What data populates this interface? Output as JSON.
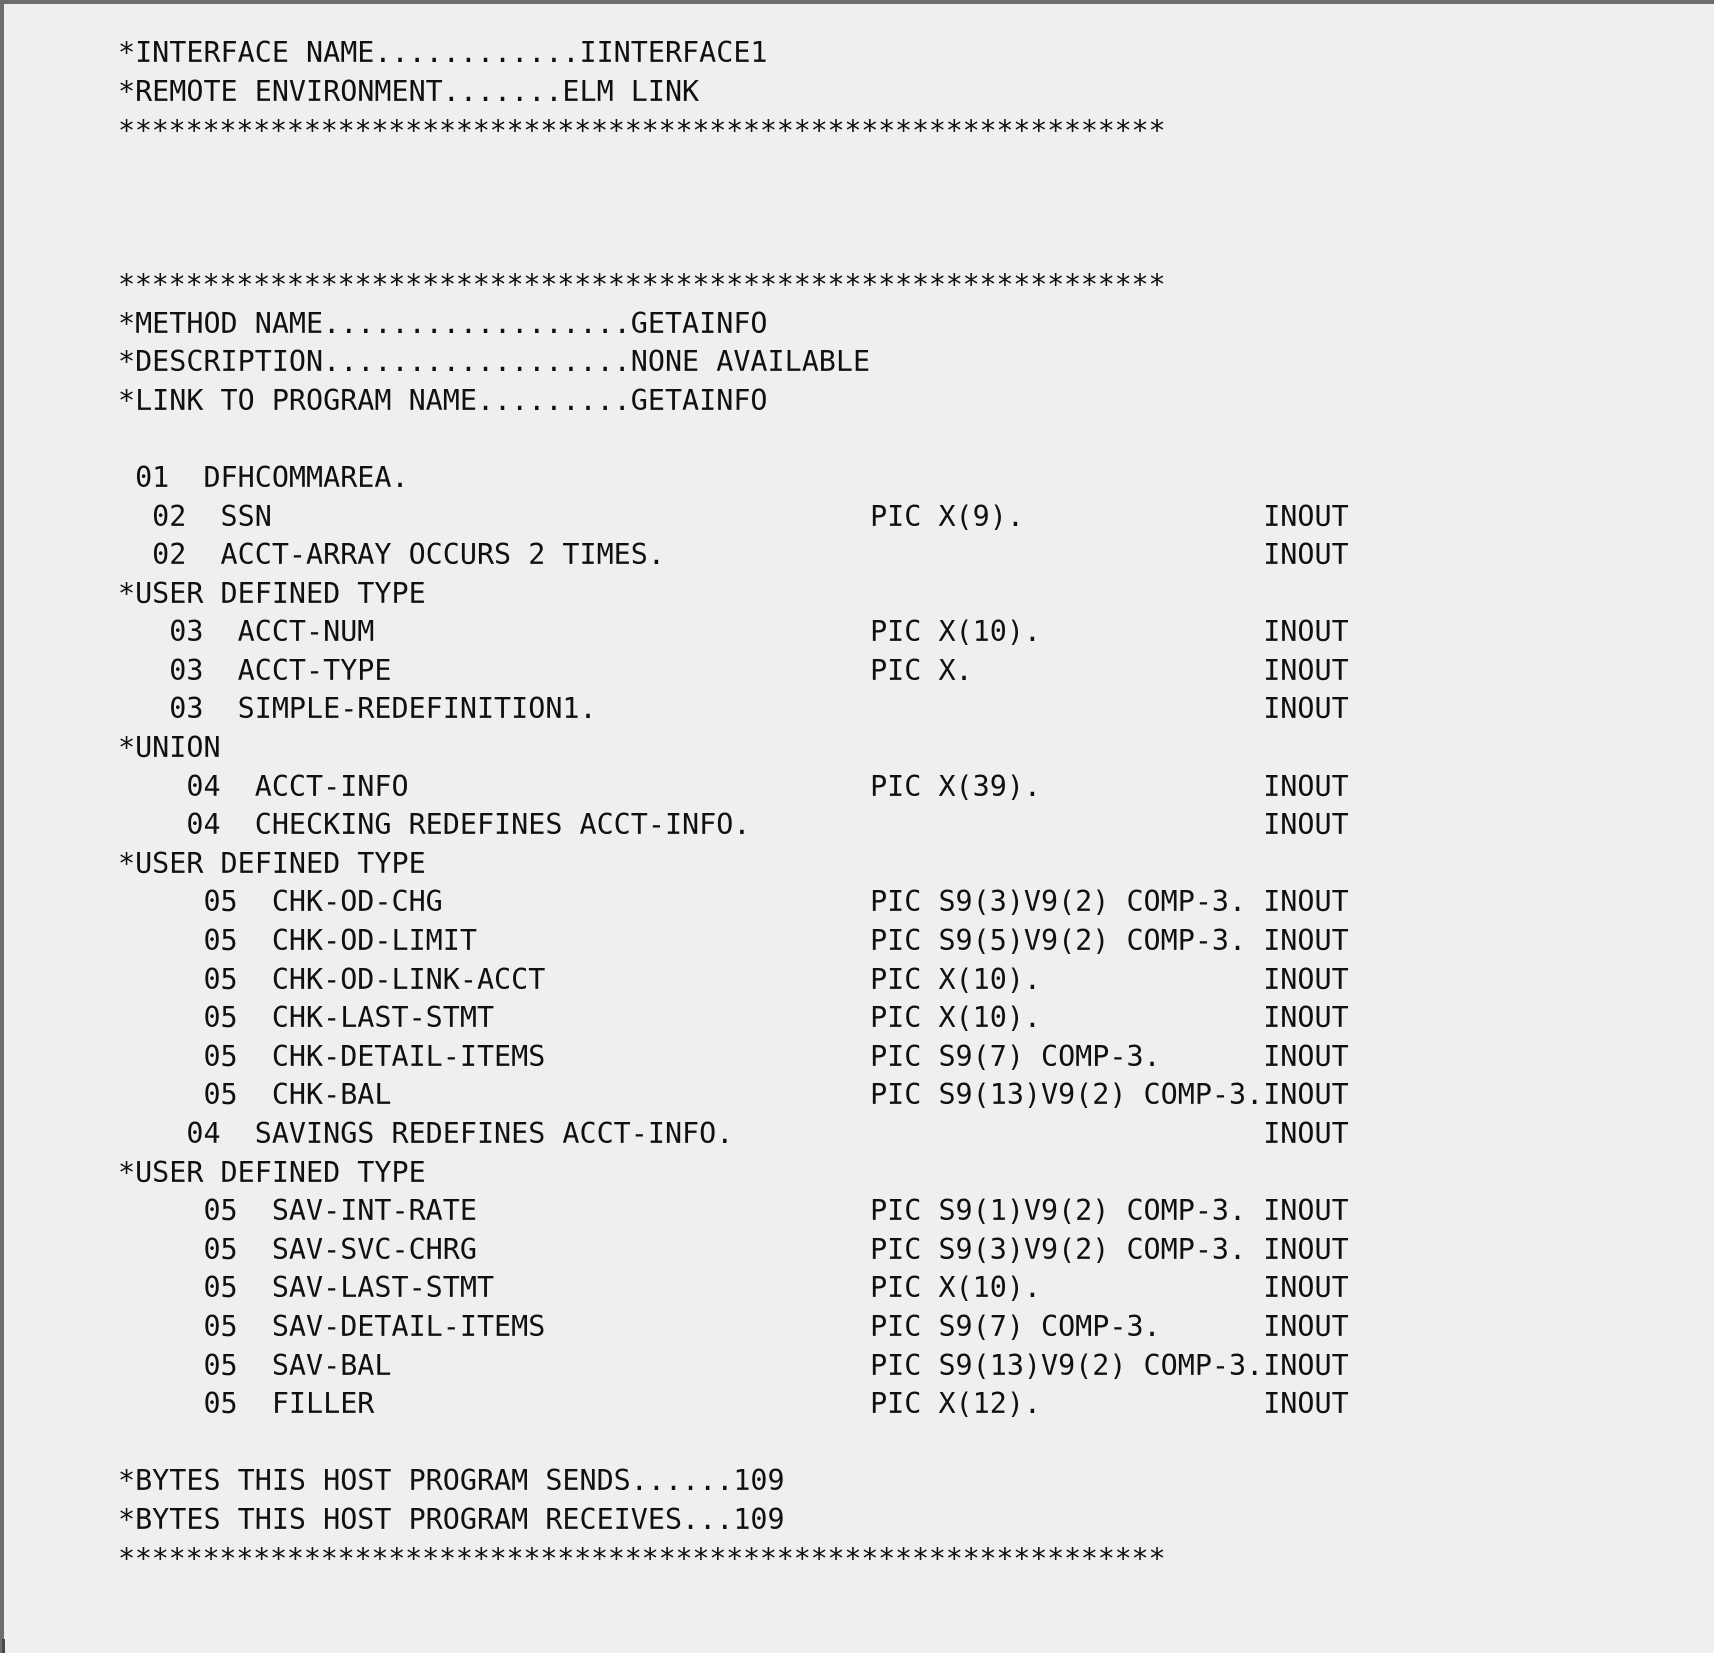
{
  "document": {
    "kind": "cobol-interface-definition-listing",
    "background_color": "#efefef",
    "text_color": "#101014",
    "frame_color": "#6d6d6d",
    "separator_rule": "**************************************************************",
    "interface_header": {
      "interface_name_label": "*INTERFACE NAME",
      "interface_name_value": "IINTERFACE1",
      "remote_environment_label": "*REMOTE ENVIRONMENT",
      "remote_environment_value": "ELM LINK"
    },
    "method_header": {
      "method_name_label": "*METHOD NAME",
      "method_name_value": "GETAINFO",
      "description_label": "*DESCRIPTION",
      "description_value": "NONE AVAILABLE",
      "link_to_program_label": "*LINK TO PROGRAM NAME",
      "link_to_program_value": "GETAINFO"
    },
    "footer": {
      "bytes_sends_label": "*BYTES THIS HOST PROGRAM SENDS",
      "bytes_sends_value": "109",
      "bytes_receives_label": "*BYTES THIS HOST PROGRAM RECEIVES",
      "bytes_receives_value": "109"
    },
    "comment_markers": {
      "user_defined_type": "*USER DEFINED TYPE",
      "union": "*UNION"
    },
    "direction_flag": "INOUT",
    "lines": [
      "*INTERFACE NAME............IINTERFACE1",
      "*REMOTE ENVIRONMENT.......ELM LINK",
      "**************************************************************",
      "",
      "",
      "",
      "**************************************************************",
      "*METHOD NAME..................GETAINFO",
      "*DESCRIPTION..................NONE AVAILABLE",
      "*LINK TO PROGRAM NAME.........GETAINFO",
      "",
      " 01  DFHCOMMAREA.",
      "  02  SSN                                   PIC X(9).              INOUT",
      "  02  ACCT-ARRAY OCCURS 2 TIMES.                                   INOUT",
      "*USER DEFINED TYPE",
      "   03  ACCT-NUM                             PIC X(10).             INOUT",
      "   03  ACCT-TYPE                            PIC X.                 INOUT",
      "   03  SIMPLE-REDEFINITION1.                                       INOUT",
      "*UNION",
      "    04  ACCT-INFO                           PIC X(39).             INOUT",
      "    04  CHECKING REDEFINES ACCT-INFO.                              INOUT",
      "*USER DEFINED TYPE",
      "     05  CHK-OD-CHG                         PIC S9(3)V9(2) COMP-3. INOUT",
      "     05  CHK-OD-LIMIT                       PIC S9(5)V9(2) COMP-3. INOUT",
      "     05  CHK-OD-LINK-ACCT                   PIC X(10).             INOUT",
      "     05  CHK-LAST-STMT                      PIC X(10).             INOUT",
      "     05  CHK-DETAIL-ITEMS                   PIC S9(7) COMP-3.      INOUT",
      "     05  CHK-BAL                            PIC S9(13)V9(2) COMP-3.INOUT",
      "    04  SAVINGS REDEFINES ACCT-INFO.                               INOUT",
      "*USER DEFINED TYPE",
      "     05  SAV-INT-RATE                       PIC S9(1)V9(2) COMP-3. INOUT",
      "     05  SAV-SVC-CHRG                       PIC S9(3)V9(2) COMP-3. INOUT",
      "     05  SAV-LAST-STMT                      PIC X(10).             INOUT",
      "     05  SAV-DETAIL-ITEMS                   PIC S9(7) COMP-3.      INOUT",
      "     05  SAV-BAL                            PIC S9(13)V9(2) COMP-3.INOUT",
      "     05  FILLER                             PIC X(12).             INOUT",
      "",
      "*BYTES THIS HOST PROGRAM SENDS......109",
      "*BYTES THIS HOST PROGRAM RECEIVES...109",
      "**************************************************************"
    ],
    "fields": [
      {
        "level": "01",
        "name": "DFHCOMMAREA.",
        "pic": "",
        "direction": ""
      },
      {
        "level": "02",
        "name": "SSN",
        "pic": "PIC X(9).",
        "direction": "INOUT"
      },
      {
        "level": "02",
        "name": "ACCT-ARRAY OCCURS 2 TIMES.",
        "pic": "",
        "direction": "INOUT"
      },
      {
        "level": "03",
        "name": "ACCT-NUM",
        "pic": "PIC X(10).",
        "direction": "INOUT"
      },
      {
        "level": "03",
        "name": "ACCT-TYPE",
        "pic": "PIC X.",
        "direction": "INOUT"
      },
      {
        "level": "03",
        "name": "SIMPLE-REDEFINITION1.",
        "pic": "",
        "direction": "INOUT"
      },
      {
        "level": "04",
        "name": "ACCT-INFO",
        "pic": "PIC X(39).",
        "direction": "INOUT"
      },
      {
        "level": "04",
        "name": "CHECKING REDEFINES ACCT-INFO.",
        "pic": "",
        "direction": "INOUT"
      },
      {
        "level": "05",
        "name": "CHK-OD-CHG",
        "pic": "PIC S9(3)V9(2) COMP-3.",
        "direction": "INOUT"
      },
      {
        "level": "05",
        "name": "CHK-OD-LIMIT",
        "pic": "PIC S9(5)V9(2) COMP-3.",
        "direction": "INOUT"
      },
      {
        "level": "05",
        "name": "CHK-OD-LINK-ACCT",
        "pic": "PIC X(10).",
        "direction": "INOUT"
      },
      {
        "level": "05",
        "name": "CHK-LAST-STMT",
        "pic": "PIC X(10).",
        "direction": "INOUT"
      },
      {
        "level": "05",
        "name": "CHK-DETAIL-ITEMS",
        "pic": "PIC S9(7) COMP-3.",
        "direction": "INOUT"
      },
      {
        "level": "05",
        "name": "CHK-BAL",
        "pic": "PIC S9(13)V9(2) COMP-3.",
        "direction": "INOUT"
      },
      {
        "level": "04",
        "name": "SAVINGS REDEFINES ACCT-INFO.",
        "pic": "",
        "direction": "INOUT"
      },
      {
        "level": "05",
        "name": "SAV-INT-RATE",
        "pic": "PIC S9(1)V9(2) COMP-3.",
        "direction": "INOUT"
      },
      {
        "level": "05",
        "name": "SAV-SVC-CHRG",
        "pic": "PIC S9(3)V9(2) COMP-3.",
        "direction": "INOUT"
      },
      {
        "level": "05",
        "name": "SAV-LAST-STMT",
        "pic": "PIC X(10).",
        "direction": "INOUT"
      },
      {
        "level": "05",
        "name": "SAV-DETAIL-ITEMS",
        "pic": "PIC S9(7) COMP-3.",
        "direction": "INOUT"
      },
      {
        "level": "05",
        "name": "SAV-BAL",
        "pic": "PIC S9(13)V9(2) COMP-3.",
        "direction": "INOUT"
      },
      {
        "level": "05",
        "name": "FILLER",
        "pic": "PIC X(12).",
        "direction": "INOUT"
      }
    ]
  }
}
